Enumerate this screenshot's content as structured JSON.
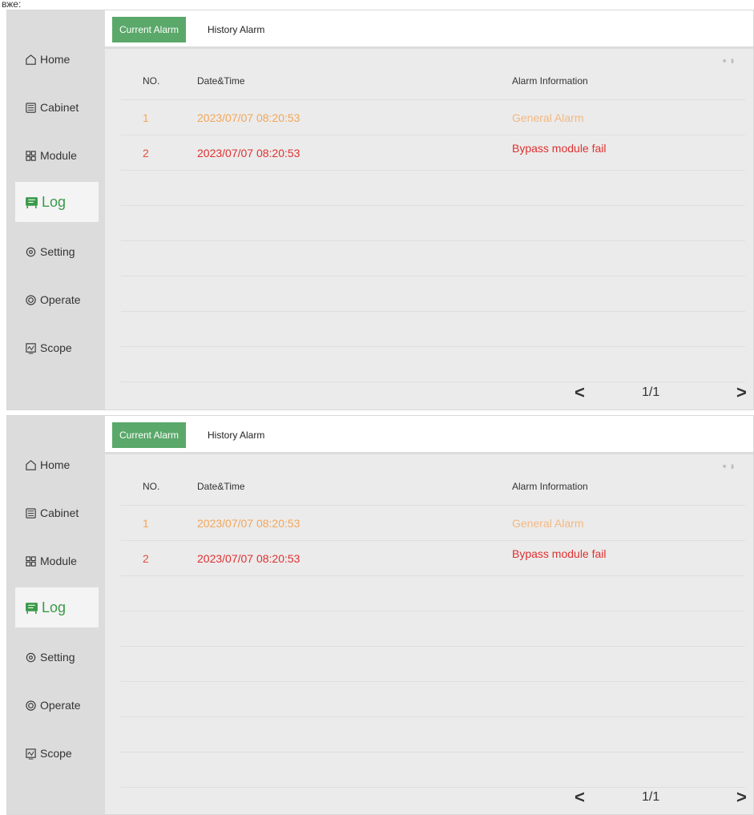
{
  "caption": "вже:",
  "colors": {
    "accent": "#5aa86a",
    "active_nav": "#3a9a4a",
    "warning": "#f2a65a",
    "critical": "#e03030"
  },
  "nav": [
    {
      "label": "Home",
      "icon": "home-icon"
    },
    {
      "label": "Cabinet",
      "icon": "cabinet-icon"
    },
    {
      "label": "Module",
      "icon": "module-icon"
    },
    {
      "label": "Log",
      "icon": "log-icon",
      "active": true
    },
    {
      "label": "Setting",
      "icon": "gear-icon"
    },
    {
      "label": "Operate",
      "icon": "operate-icon"
    },
    {
      "label": "Scope",
      "icon": "scope-icon"
    }
  ],
  "tabs": {
    "current": "Current Alarm",
    "history": "History Alarm"
  },
  "table": {
    "headers": {
      "no": "NO.",
      "datetime": "Date&Time",
      "info": "Alarm Information"
    },
    "rows": [
      {
        "no": "1",
        "datetime": "2023/07/07 08:20:53",
        "info": "General Alarm",
        "level": "warning"
      },
      {
        "no": "2",
        "datetime": "2023/07/07 08:20:53",
        "info": "Bypass module fail",
        "level": "critical"
      }
    ]
  },
  "pager": {
    "prev": "<",
    "page": "1/1",
    "next": ">"
  }
}
